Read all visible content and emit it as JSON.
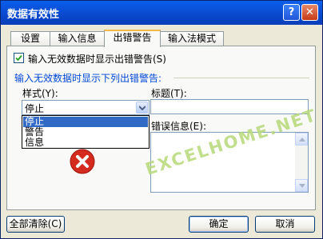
{
  "window": {
    "title": "数据有效性",
    "help_label": "?",
    "close_label": "✕"
  },
  "tabs": [
    {
      "label": "设置"
    },
    {
      "label": "输入信息"
    },
    {
      "label": "出错警告"
    },
    {
      "label": "输入法模式"
    }
  ],
  "active_tab": "出错警告",
  "error_alert": {
    "show_alert_checkbox": {
      "label": "输入无效数据时显示出错警告(S)",
      "checked": true
    },
    "group_label": "输入无效数据时显示下列出错警告:",
    "style": {
      "label": "样式(Y):",
      "selected": "停止",
      "options": [
        "停止",
        "警告",
        "信息"
      ]
    },
    "title": {
      "label": "标题(T):",
      "value": ""
    },
    "message": {
      "label": "错误信息(E):",
      "value": ""
    },
    "icon": "error-stop-icon"
  },
  "footer": {
    "clear_all_label": "全部清除(C)",
    "ok_label": "确定",
    "cancel_label": "取消"
  },
  "watermark": "EXCELHOME.NET",
  "colors": {
    "titlebar": "#0A4FD8",
    "selection": "#316AC5",
    "group_label": "#0046D5",
    "error_icon": "#D52B1E",
    "watermark": "#B7D979"
  }
}
